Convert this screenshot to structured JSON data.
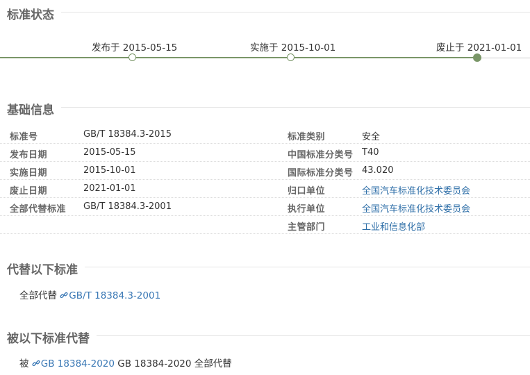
{
  "status": {
    "title": "标准状态",
    "published": "发布于 2015-05-15",
    "implemented": "实施于 2015-10-01",
    "abolished": "废止于 2021-01-01"
  },
  "basic": {
    "title": "基础信息",
    "rows": [
      {
        "l1": "标准号",
        "v1": "GB/T 18384.3-2015",
        "l2": "标准类别",
        "v2": "安全"
      },
      {
        "l1": "发布日期",
        "v1": "2015-05-15",
        "l2": "中国标准分类号",
        "v2": "T40"
      },
      {
        "l1": "实施日期",
        "v1": "2015-10-01",
        "l2": "国际标准分类号",
        "v2": "43.020"
      },
      {
        "l1": "废止日期",
        "v1": "2021-01-01",
        "l2": "归口单位",
        "v2": "全国汽车标准化技术委员会"
      },
      {
        "l1": "全部代替标准",
        "v1": "GB/T 18384.3-2001",
        "l2": "执行单位",
        "v2": "全国汽车标准化技术委员会"
      },
      {
        "l1": "",
        "v1": "",
        "l2": "主管部门",
        "v2": "工业和信息化部"
      }
    ]
  },
  "replaces": {
    "title": "代替以下标准",
    "prefix": "全部代替",
    "link": "GB/T 18384.3-2001"
  },
  "replaced_by": {
    "title": "被以下标准代替",
    "prefix": "被",
    "link": "GB 18384-2020",
    "suffix": "GB 18384-2020 全部代替"
  },
  "colors": {
    "accent": "#7a9668",
    "link": "#2f6fa8"
  },
  "icons": [
    "link-icon"
  ]
}
